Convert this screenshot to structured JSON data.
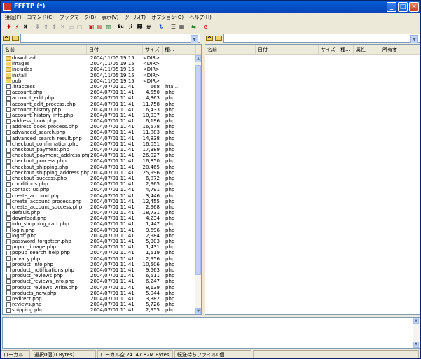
{
  "window": {
    "title": "FFFTP (*)"
  },
  "menu": [
    "接続(F)",
    "コマンド(C)",
    "ブックマーク(B)",
    "表示(V)",
    "ツール(T)",
    "オプション(O)",
    "ヘルプ(H)"
  ],
  "toolbar": {
    "buttons": [
      {
        "name": "connect-icon",
        "glyph": "♦",
        "color": "#c00000"
      },
      {
        "name": "quick-connect-icon",
        "glyph": "⚡",
        "color": "#c00000"
      },
      {
        "name": "disconnect-icon",
        "glyph": "✖",
        "color": "#202020"
      },
      {
        "name": "download-icon",
        "glyph": "⬇",
        "color": "#a0a0a0"
      },
      {
        "name": "upload-icon",
        "glyph": "⬆",
        "color": "#a0a0a0"
      },
      {
        "name": "mirror-upload-icon",
        "glyph": "⬆",
        "color": "#a0a0a0"
      },
      {
        "name": "delete-icon",
        "glyph": "✕",
        "color": "#a0a0a0"
      },
      {
        "name": "rename-icon",
        "glyph": "▭",
        "color": "#a0a0a0"
      },
      {
        "name": "mkdir-icon",
        "glyph": "▢",
        "color": "#a0a0a0"
      },
      {
        "name": "file-binary-icon",
        "glyph": "▣",
        "color": "#c02020"
      },
      {
        "name": "file-ascii-icon",
        "glyph": "▤",
        "color": "#c02020"
      },
      {
        "name": "file-auto-icon",
        "glyph": "▥",
        "color": "#206020"
      },
      {
        "name": "euc-icon",
        "glyph": "Eu",
        "color": "#000000"
      },
      {
        "name": "jis-icon",
        "glyph": "Ji",
        "color": "#000000"
      },
      {
        "name": "no-convert-icon",
        "glyph": "無",
        "color": "#000000"
      },
      {
        "name": "kana-icon",
        "glyph": "ｶﾅ",
        "color": "#000000"
      },
      {
        "name": "refresh-icon",
        "glyph": "↻",
        "color": "#1040c0"
      },
      {
        "name": "list-view-icon",
        "glyph": "☰",
        "color": "#404040"
      },
      {
        "name": "detail-view-icon",
        "glyph": "▦",
        "color": "#404040"
      },
      {
        "name": "sync-icon",
        "glyph": "⇆",
        "color": "#208020"
      },
      {
        "name": "stop-icon",
        "glyph": "⊘",
        "color": "#d02020"
      }
    ]
  },
  "local_pane": {
    "columns": [
      "名前",
      "日付",
      "サイズ",
      "種..."
    ],
    "files": [
      {
        "name": "download",
        "date": "2004/11/05 19:15",
        "size": "<DIR>",
        "type": "",
        "folder": true
      },
      {
        "name": "images",
        "date": "2004/11/05 19:15",
        "size": "<DIR>",
        "type": "",
        "folder": true
      },
      {
        "name": "includes",
        "date": "2004/11/05 19:15",
        "size": "<DIR>",
        "type": "",
        "folder": true
      },
      {
        "name": "install",
        "date": "2004/11/05 19:15",
        "size": "<DIR>",
        "type": "",
        "folder": true
      },
      {
        "name": "pub",
        "date": "2004/11/05 19:15",
        "size": "<DIR>",
        "type": "",
        "folder": true
      },
      {
        "name": ".htaccess",
        "date": "2004/07/01 11:41",
        "size": "668",
        "type": "hta...",
        "folder": false
      },
      {
        "name": "account.php",
        "date": "2004/07/01 11:41",
        "size": "4,550",
        "type": "php",
        "folder": false
      },
      {
        "name": "account_edit.php",
        "date": "2004/07/01 11:41",
        "size": "4,363",
        "type": "php",
        "folder": false
      },
      {
        "name": "account_edit_process.php",
        "date": "2004/07/01 11:41",
        "size": "11,758",
        "type": "php",
        "folder": false
      },
      {
        "name": "account_history.php",
        "date": "2004/07/01 11:41",
        "size": "6,433",
        "type": "php",
        "folder": false
      },
      {
        "name": "account_history_info.php",
        "date": "2004/07/01 11:41",
        "size": "10,937",
        "type": "php",
        "folder": false
      },
      {
        "name": "address_book.php",
        "date": "2004/07/01 11:41",
        "size": "6,196",
        "type": "php",
        "folder": false
      },
      {
        "name": "address_book_process.php",
        "date": "2004/07/01 11:41",
        "size": "16,578",
        "type": "php",
        "folder": false
      },
      {
        "name": "advanced_search.php",
        "date": "2004/07/01 11:41",
        "size": "11,883",
        "type": "php",
        "folder": false
      },
      {
        "name": "advanced_search_result.php",
        "date": "2004/07/01 11:41",
        "size": "14,838",
        "type": "php",
        "folder": false
      },
      {
        "name": "checkout_confirmation.php",
        "date": "2004/07/01 11:41",
        "size": "16,051",
        "type": "php",
        "folder": false
      },
      {
        "name": "checkout_payment.php",
        "date": "2004/07/01 11:41",
        "size": "17,389",
        "type": "php",
        "folder": false
      },
      {
        "name": "checkout_payment_address.php",
        "date": "2004/07/01 11:41",
        "size": "26,027",
        "type": "php",
        "folder": false
      },
      {
        "name": "checkout_process.php",
        "date": "2004/07/01 11:41",
        "size": "16,850",
        "type": "php",
        "folder": false
      },
      {
        "name": "checkout_shipping.php",
        "date": "2004/07/01 11:41",
        "size": "20,465",
        "type": "php",
        "folder": false
      },
      {
        "name": "checkout_shipping_address.php",
        "date": "2004/07/01 11:41",
        "size": "25,996",
        "type": "php",
        "folder": false
      },
      {
        "name": "checkout_success.php",
        "date": "2004/07/01 11:41",
        "size": "6,872",
        "type": "php",
        "folder": false
      },
      {
        "name": "conditions.php",
        "date": "2004/07/01 11:41",
        "size": "2,965",
        "type": "php",
        "folder": false
      },
      {
        "name": "contact_us.php",
        "date": "2004/07/01 11:41",
        "size": "4,791",
        "type": "php",
        "folder": false
      },
      {
        "name": "create_account.php",
        "date": "2004/07/01 11:41",
        "size": "3,446",
        "type": "php",
        "folder": false
      },
      {
        "name": "create_account_process.php",
        "date": "2004/07/01 11:41",
        "size": "12,455",
        "type": "php",
        "folder": false
      },
      {
        "name": "create_account_success.php",
        "date": "2004/07/01 11:41",
        "size": "2,968",
        "type": "php",
        "folder": false
      },
      {
        "name": "default.php",
        "date": "2004/07/01 11:41",
        "size": "18,731",
        "type": "php",
        "folder": false
      },
      {
        "name": "download.php",
        "date": "2004/07/01 11:41",
        "size": "4,234",
        "type": "php",
        "folder": false
      },
      {
        "name": "info_shopping_cart.php",
        "date": "2004/07/01 11:41",
        "size": "1,447",
        "type": "php",
        "folder": false
      },
      {
        "name": "login.php",
        "date": "2004/07/01 11:41",
        "size": "9,696",
        "type": "php",
        "folder": false
      },
      {
        "name": "logoff.php",
        "date": "2004/07/01 11:41",
        "size": "2,984",
        "type": "php",
        "folder": false
      },
      {
        "name": "password_forgotten.php",
        "date": "2004/07/01 11:41",
        "size": "5,303",
        "type": "php",
        "folder": false
      },
      {
        "name": "popup_image.php",
        "date": "2004/07/01 11:41",
        "size": "1,431",
        "type": "php",
        "folder": false
      },
      {
        "name": "popup_search_help.php",
        "date": "2004/07/01 11:41",
        "size": "1,519",
        "type": "php",
        "folder": false
      },
      {
        "name": "privacy.php",
        "date": "2004/07/01 11:41",
        "size": "2,956",
        "type": "php",
        "folder": false
      },
      {
        "name": "product_info.php",
        "date": "2004/07/01 11:41",
        "size": "10,506",
        "type": "php",
        "folder": false
      },
      {
        "name": "product_notifications.php",
        "date": "2004/07/01 11:41",
        "size": "9,563",
        "type": "php",
        "folder": false
      },
      {
        "name": "product_reviews.php",
        "date": "2004/07/01 11:41",
        "size": "6,511",
        "type": "php",
        "folder": false
      },
      {
        "name": "product_reviews_info.php",
        "date": "2004/07/01 11:41",
        "size": "6,247",
        "type": "php",
        "folder": false
      },
      {
        "name": "product_reviews_write.php",
        "date": "2004/07/01 11:41",
        "size": "8,139",
        "type": "php",
        "folder": false
      },
      {
        "name": "products_new.php",
        "date": "2004/07/01 11:41",
        "size": "5,044",
        "type": "php",
        "folder": false
      },
      {
        "name": "redirect.php",
        "date": "2004/07/01 11:41",
        "size": "3,382",
        "type": "php",
        "folder": false
      },
      {
        "name": "reviews.php",
        "date": "2004/07/01 11:41",
        "size": "5,726",
        "type": "php",
        "folder": false
      },
      {
        "name": "shipping.php",
        "date": "2004/07/01 11:41",
        "size": "2,955",
        "type": "php",
        "folder": false
      }
    ]
  },
  "remote_pane": {
    "columns": [
      "名前",
      "日付",
      "サイズ",
      "種...",
      "属性",
      "所有者"
    ]
  },
  "statusbar": {
    "mode": "ローカル",
    "selected": "選択0個(0 Bytes)",
    "free": "ローカル空 24147.82M Bytes",
    "queue": "転送待ちファイル0個"
  }
}
